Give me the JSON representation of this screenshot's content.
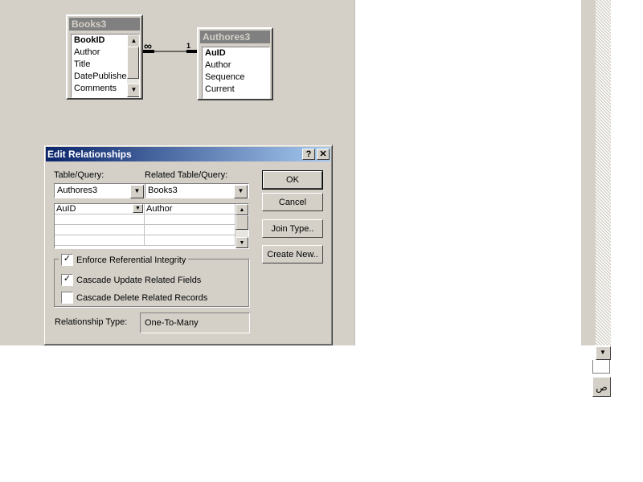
{
  "books_table": {
    "title": "Books3",
    "fields": [
      {
        "name": "BookID",
        "primary_key": true
      },
      {
        "name": "Author",
        "primary_key": false
      },
      {
        "name": "Title",
        "primary_key": false
      },
      {
        "name": "DatePublished",
        "primary_key": false
      },
      {
        "name": "Comments",
        "primary_key": false
      }
    ]
  },
  "authors_table": {
    "title": "Authores3",
    "fields": [
      {
        "name": "AuID",
        "primary_key": true
      },
      {
        "name": "Author",
        "primary_key": false
      },
      {
        "name": "Sequence",
        "primary_key": false
      },
      {
        "name": "Current",
        "primary_key": false
      }
    ]
  },
  "relationship_line": {
    "many_symbol": "∞",
    "one_symbol": "1"
  },
  "dialog": {
    "title": "Edit Relationships",
    "help_glyph": "?",
    "close_glyph": "✕",
    "table_query_label": "Table/Query:",
    "related_table_query_label": "Related Table/Query:",
    "table_query_value": "Authores3",
    "related_table_query_value": "Books3",
    "field_pairs": [
      {
        "left": "AuID",
        "right": "Author"
      }
    ],
    "buttons": {
      "ok": "OK",
      "cancel": "Cancel",
      "join_type": "Join Type..",
      "create_new": "Create New.."
    },
    "enforce_integrity": {
      "label": "Enforce Referential Integrity",
      "checked": true
    },
    "cascade_update": {
      "label": "Cascade Update Related Fields",
      "checked": true
    },
    "cascade_delete": {
      "label": "Cascade Delete Related Records",
      "checked": false
    },
    "relationship_type_label": "Relationship Type:",
    "relationship_type_value": "One-To-Many"
  },
  "side_button_glyph": "ص",
  "check_glyph": "✓",
  "arrow_up_glyph": "▲",
  "arrow_down_glyph": "▼"
}
